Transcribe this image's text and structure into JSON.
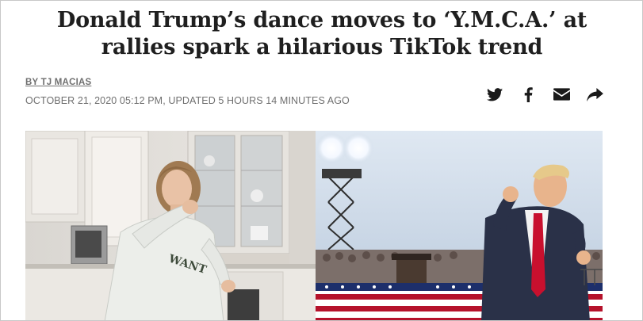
{
  "article": {
    "headline": "Donald Trump’s dance moves to ‘Y.M.C.A.’ at rallies spark a hilarious TikTok trend",
    "byline": "BY TJ MACIAS",
    "dateline": "OCTOBER 21, 2020 05:12 PM, UPDATED 5 HOURS 14 MINUTES AGO"
  },
  "share": {
    "icons": [
      "twitter-icon",
      "facebook-icon",
      "email-icon",
      "share-arrow-icon"
    ],
    "icon_color": "#1a1a1a"
  },
  "hero_image": {
    "left_panel": "woman dancing in a white kitchen wearing a sweatshirt",
    "right_panel": "Donald Trump dancing on stage at a rally",
    "sweatshirt_text": "WANT"
  },
  "colors": {
    "headline": "#1f1f1f",
    "meta": "#6f6f6f",
    "tie_red": "#c8102e"
  }
}
